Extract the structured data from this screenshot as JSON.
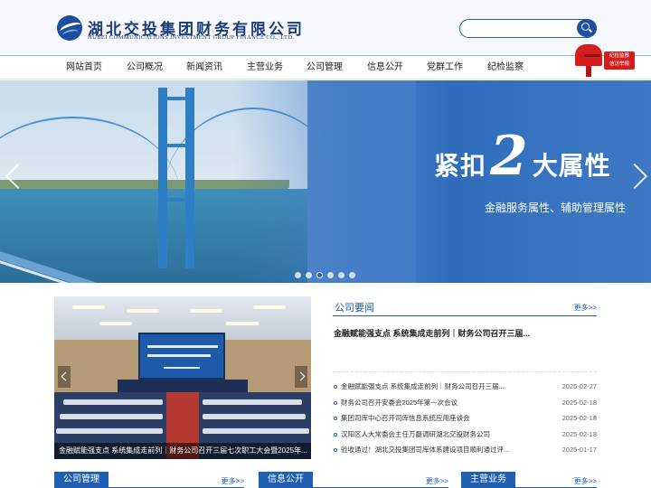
{
  "header": {
    "logo_cn": "湖北交投集团财务有限公司",
    "logo_en": "HUBEI COMMUNICATIONS INVESTMENT GROUP FINANCE CO., LTD.",
    "search_placeholder": ""
  },
  "nav": {
    "items": [
      {
        "label": "网站首页"
      },
      {
        "label": "公司概况"
      },
      {
        "label": "新闻资讯"
      },
      {
        "label": "主营业务"
      },
      {
        "label": "公司管理"
      },
      {
        "label": "信息公开"
      },
      {
        "label": "党群工作"
      },
      {
        "label": "纪检监察"
      }
    ]
  },
  "mailbox": {
    "line1": "纪检监察",
    "line2": "信访举报"
  },
  "banner": {
    "slogan_pre": "紧扣",
    "slogan_num": "2",
    "slogan_post": "大属性",
    "slogan_sub": "金融服务属性、辅助管理属性",
    "slide_count": 6,
    "active_slide": 3
  },
  "photo_news": {
    "caption": "金融赋能强支点 系统集成走前列｜财务公司召开三届七次职工大会暨2025年..."
  },
  "company_news": {
    "title": "公司要闻",
    "more": "更多>>",
    "headline": "金融赋能强支点 系统集成走前列｜财务公司召开三届...",
    "items": [
      {
        "text": "金融赋能强支点 系统集成走前列｜财务公司召开三届...",
        "date": "2025-02-27"
      },
      {
        "text": "财务公司召开安委会2025年第一次会议",
        "date": "2025-02-18"
      },
      {
        "text": "集团司库中心召开司库信息系统应用座谈会",
        "date": "2025-02-18"
      },
      {
        "text": "汉阳区人大常委会主任万磊调研湖北交投财务公司",
        "date": "2025-02-18"
      },
      {
        "text": "验收通过！湖北交投集团司库体系建设项目顺利通过评...",
        "date": "2025-01-17"
      }
    ]
  },
  "sections": [
    {
      "title": "公司管理",
      "more": "更多>>"
    },
    {
      "title": "信息公开",
      "more": "更多>>"
    },
    {
      "title": "主营业务",
      "more": "更多>>"
    }
  ]
}
